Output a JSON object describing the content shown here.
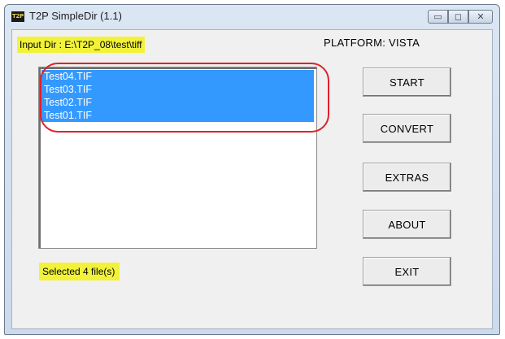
{
  "window": {
    "title": "T2P SimpleDir (1.1)",
    "icon_text": "T2P",
    "minimize_glyph": "▭",
    "maximize_glyph": "◻",
    "close_glyph": "✕"
  },
  "header": {
    "input_dir": "Input Dir :  E:\\T2P_08\\test\\tiff",
    "platform": "PLATFORM:  VISTA"
  },
  "file_list": {
    "items": [
      "Test04.TIF",
      "Test03.TIF",
      "Test02.TIF",
      "Test01.TIF"
    ],
    "selected_color": "#3399ff"
  },
  "status": {
    "text": "Selected 4 file(s)",
    "highlight_color": "#f2f23a"
  },
  "buttons": {
    "start": "START",
    "convert": "CONVERT",
    "extras": "EXTRAS",
    "about": "ABOUT",
    "exit": "EXIT"
  },
  "annotation": {
    "outline_color": "#e0202a"
  }
}
